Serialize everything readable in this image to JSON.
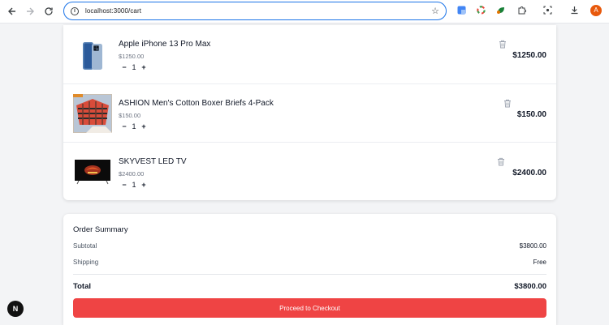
{
  "browser": {
    "url": "localhost:3000/cart",
    "avatar_initial": "A"
  },
  "cart": {
    "items": [
      {
        "name": "Apple iPhone 13 Pro Max",
        "unit_price": "$1250.00",
        "quantity": "1",
        "line_total": "$1250.00",
        "minus": "−",
        "plus": "+"
      },
      {
        "name": "ASHION Men's Cotton Boxer Briefs 4-Pack",
        "unit_price": "$150.00",
        "quantity": "1",
        "line_total": "$150.00",
        "minus": "−",
        "plus": "+"
      },
      {
        "name": "SKYVEST LED TV",
        "unit_price": "$2400.00",
        "quantity": "1",
        "line_total": "$2400.00",
        "minus": "−",
        "plus": "+"
      }
    ]
  },
  "summary": {
    "title": "Order Summary",
    "subtotal_label": "Subtotal",
    "subtotal_value": "$3800.00",
    "shipping_label": "Shipping",
    "shipping_value": "Free",
    "total_label": "Total",
    "total_value": "$3800.00",
    "checkout_label": "Proceed to Checkout"
  },
  "dev": {
    "badge": "N"
  },
  "colors": {
    "accent": "#ef4444",
    "omnibox_border": "#1a73e8"
  }
}
